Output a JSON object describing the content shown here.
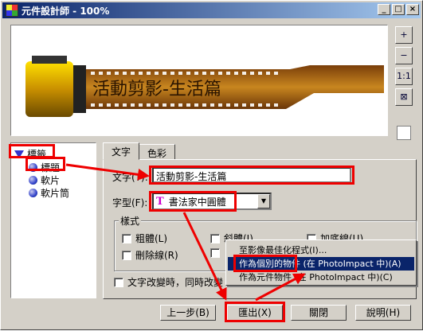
{
  "window": {
    "title": "元件設計師 - 100%",
    "buttons": [
      "_",
      "□",
      "×"
    ]
  },
  "preview": {
    "banner_text": "活動剪影-生活篇"
  },
  "zoom": {
    "buttons": [
      "+",
      "−",
      "1:1",
      "⊠"
    ]
  },
  "tree": {
    "root": "標籤",
    "items": [
      "標題",
      "軟片",
      "軟片筒"
    ]
  },
  "tabs": [
    "文字",
    "色彩"
  ],
  "text_tab": {
    "text_label": "文字(T):",
    "text_value": "活動剪影-生活篇",
    "font_label": "字型(F):",
    "font_value": "書法家中圓體",
    "style_group": "樣式",
    "styles": [
      "粗體(L)",
      "斜體(I)",
      "加底線(U)",
      "刪除線(R)",
      ""
    ],
    "auto_update_label": "文字改變時，同時改變"
  },
  "context_menu": {
    "items": [
      "至影像最佳化程式(I)...",
      "作為個別的物件 (在 PhotoImpact 中)(A)",
      "作為元件物件 (在 PhotoImpact 中)(C)"
    ],
    "selected_index": 1
  },
  "footer": {
    "prev_button": "上一步(B)",
    "export_button": "匯出(X)",
    "close_button": "關閉",
    "help_button": "說明(H)"
  },
  "colors": {
    "annotation": "#e00000",
    "titlebar": "#0a246a",
    "menu_selected": "#0a246a"
  }
}
